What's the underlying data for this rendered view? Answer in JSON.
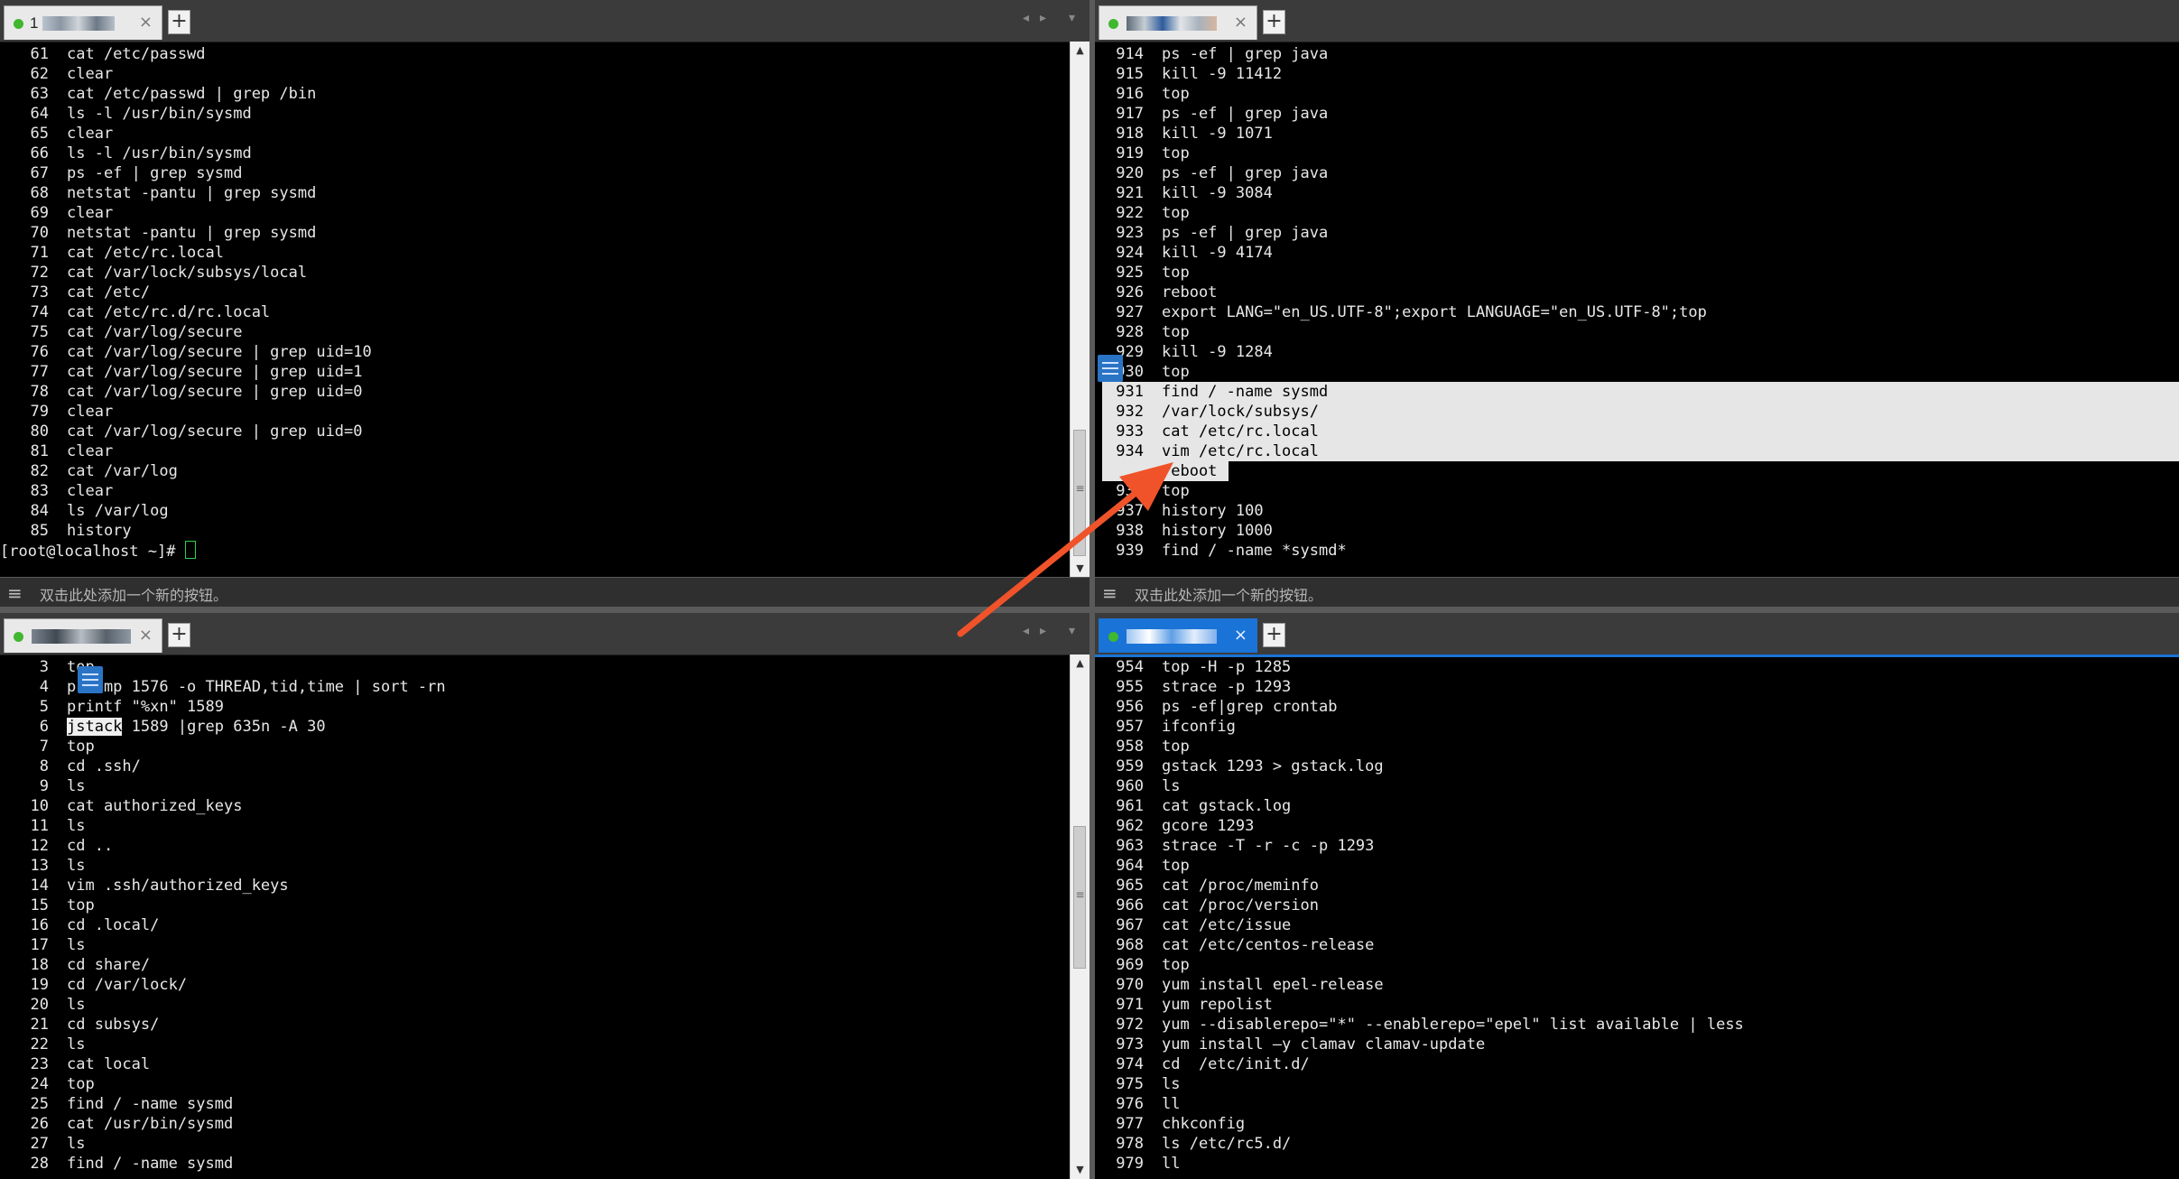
{
  "button_bar_hint": "双击此处添加一个新的按钮。",
  "accent_arrow_color": "#f0532a",
  "panes": {
    "top_left": {
      "tab_label": "1",
      "lines": [
        {
          "n": "61",
          "cmd": "cat /etc/passwd"
        },
        {
          "n": "62",
          "cmd": "clear"
        },
        {
          "n": "63",
          "cmd": "cat /etc/passwd | grep /bin"
        },
        {
          "n": "64",
          "cmd": "ls -l /usr/bin/sysmd"
        },
        {
          "n": "65",
          "cmd": "clear"
        },
        {
          "n": "66",
          "cmd": "ls -l /usr/bin/sysmd"
        },
        {
          "n": "67",
          "cmd": "ps -ef | grep sysmd"
        },
        {
          "n": "68",
          "cmd": "netstat -pantu | grep sysmd"
        },
        {
          "n": "69",
          "cmd": "clear"
        },
        {
          "n": "70",
          "cmd": "netstat -pantu | grep sysmd"
        },
        {
          "n": "71",
          "cmd": "cat /etc/rc.local"
        },
        {
          "n": "72",
          "cmd": "cat /var/lock/subsys/local"
        },
        {
          "n": "73",
          "cmd": "cat /etc/"
        },
        {
          "n": "74",
          "cmd": "cat /etc/rc.d/rc.local"
        },
        {
          "n": "75",
          "cmd": "cat /var/log/secure"
        },
        {
          "n": "76",
          "cmd": "cat /var/log/secure | grep uid=10"
        },
        {
          "n": "77",
          "cmd": "cat /var/log/secure | grep uid=1"
        },
        {
          "n": "78",
          "cmd": "cat /var/log/secure | grep uid=0"
        },
        {
          "n": "79",
          "cmd": "clear"
        },
        {
          "n": "80",
          "cmd": "cat /var/log/secure | grep uid=0"
        },
        {
          "n": "81",
          "cmd": "clear"
        },
        {
          "n": "82",
          "cmd": "cat /var/log"
        },
        {
          "n": "83",
          "cmd": "clear"
        },
        {
          "n": "84",
          "cmd": "ls /var/log"
        },
        {
          "n": "85",
          "cmd": "history"
        }
      ],
      "prompt": "[root@localhost ~]# "
    },
    "top_right": {
      "lines": [
        {
          "n": "914",
          "cmd": "ps -ef | grep java"
        },
        {
          "n": "915",
          "cmd": "kill -9 11412"
        },
        {
          "n": "916",
          "cmd": "top"
        },
        {
          "n": "917",
          "cmd": "ps -ef | grep java"
        },
        {
          "n": "918",
          "cmd": "kill -9 1071"
        },
        {
          "n": "919",
          "cmd": "top"
        },
        {
          "n": "920",
          "cmd": "ps -ef | grep java"
        },
        {
          "n": "921",
          "cmd": "kill -9 3084"
        },
        {
          "n": "922",
          "cmd": "top"
        },
        {
          "n": "923",
          "cmd": "ps -ef | grep java"
        },
        {
          "n": "924",
          "cmd": "kill -9 4174"
        },
        {
          "n": "925",
          "cmd": "top"
        },
        {
          "n": "926",
          "cmd": "reboot"
        },
        {
          "n": "927",
          "cmd": "export LANG=\"en_US.UTF-8\";export LANGUAGE=\"en_US.UTF-8\";top"
        },
        {
          "n": "928",
          "cmd": "top"
        },
        {
          "n": "929",
          "cmd": "kill -9 1284"
        },
        {
          "n": "930",
          "cmd": "top"
        },
        {
          "n": "931",
          "cmd": "find / -name sysmd"
        },
        {
          "n": "932",
          "cmd": "/var/lock/subsys/"
        },
        {
          "n": "933",
          "cmd": "cat /etc/rc.local"
        },
        {
          "n": "934",
          "cmd": "vim /etc/rc.local"
        },
        {
          "n": "",
          "cmd": "reboot"
        },
        {
          "n": "936",
          "cmd": "top"
        },
        {
          "n": "937",
          "cmd": "history 100"
        },
        {
          "n": "938",
          "cmd": "history 1000"
        },
        {
          "n": "939",
          "cmd": "find / -name *sysmd*"
        }
      ]
    },
    "bottom_left": {
      "lines": [
        {
          "n": "3",
          "cmd": "top"
        },
        {
          "n": "4",
          "cmd": "ps -mp 1576 -o THREAD,tid,time | sort -rn"
        },
        {
          "n": "5",
          "cmd": "printf \"%xn\" 1589"
        },
        {
          "n": "6",
          "cmd": "jstack 1589 |grep 635n -A 30"
        },
        {
          "n": "7",
          "cmd": "top"
        },
        {
          "n": "8",
          "cmd": "cd .ssh/"
        },
        {
          "n": "9",
          "cmd": "ls"
        },
        {
          "n": "10",
          "cmd": "cat authorized_keys"
        },
        {
          "n": "11",
          "cmd": "ls"
        },
        {
          "n": "12",
          "cmd": "cd .."
        },
        {
          "n": "13",
          "cmd": "ls"
        },
        {
          "n": "14",
          "cmd": "vim .ssh/authorized_keys"
        },
        {
          "n": "15",
          "cmd": "top"
        },
        {
          "n": "16",
          "cmd": "cd .local/"
        },
        {
          "n": "17",
          "cmd": "ls"
        },
        {
          "n": "18",
          "cmd": "cd share/"
        },
        {
          "n": "19",
          "cmd": "cd /var/lock/"
        },
        {
          "n": "20",
          "cmd": "ls"
        },
        {
          "n": "21",
          "cmd": "cd subsys/"
        },
        {
          "n": "22",
          "cmd": "ls"
        },
        {
          "n": "23",
          "cmd": "cat local"
        },
        {
          "n": "24",
          "cmd": "top"
        },
        {
          "n": "25",
          "cmd": "find / -name sysmd"
        },
        {
          "n": "26",
          "cmd": "cat /usr/bin/sysmd"
        },
        {
          "n": "27",
          "cmd": "ls"
        },
        {
          "n": "28",
          "cmd": "find / -name sysmd"
        }
      ]
    },
    "bottom_right": {
      "lines": [
        {
          "n": "954",
          "cmd": "top -H -p 1285"
        },
        {
          "n": "955",
          "cmd": "strace -p 1293"
        },
        {
          "n": "956",
          "cmd": "ps -ef|grep crontab"
        },
        {
          "n": "957",
          "cmd": "ifconfig"
        },
        {
          "n": "958",
          "cmd": "top"
        },
        {
          "n": "959",
          "cmd": "gstack 1293 > gstack.log"
        },
        {
          "n": "960",
          "cmd": "ls"
        },
        {
          "n": "961",
          "cmd": "cat gstack.log"
        },
        {
          "n": "962",
          "cmd": "gcore 1293"
        },
        {
          "n": "963",
          "cmd": "strace -T -r -c -p 1293"
        },
        {
          "n": "964",
          "cmd": "top"
        },
        {
          "n": "965",
          "cmd": "cat /proc/meminfo"
        },
        {
          "n": "966",
          "cmd": "cat /proc/version"
        },
        {
          "n": "967",
          "cmd": "cat /etc/issue"
        },
        {
          "n": "968",
          "cmd": "cat /etc/centos-release"
        },
        {
          "n": "969",
          "cmd": "top"
        },
        {
          "n": "970",
          "cmd": "yum install epel-release"
        },
        {
          "n": "971",
          "cmd": "yum repolist"
        },
        {
          "n": "972",
          "cmd": "yum --disablerepo=\"*\" --enablerepo=\"epel\" list available | less"
        },
        {
          "n": "973",
          "cmd": "yum install –y clamav clamav-update"
        },
        {
          "n": "974",
          "cmd": "cd  /etc/init.d/"
        },
        {
          "n": "975",
          "cmd": "ls"
        },
        {
          "n": "976",
          "cmd": "ll"
        },
        {
          "n": "977",
          "cmd": "chkconfig"
        },
        {
          "n": "978",
          "cmd": "ls /etc/rc5.d/"
        },
        {
          "n": "979",
          "cmd": "ll"
        }
      ]
    }
  }
}
